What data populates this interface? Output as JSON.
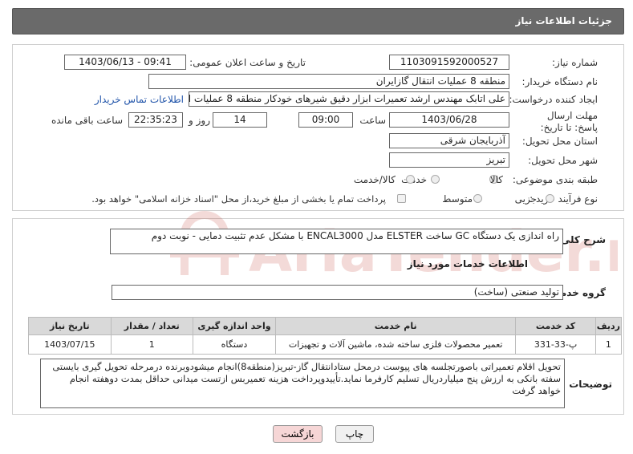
{
  "header": {
    "title": "جزئیات اطلاعات نیاز"
  },
  "fields": {
    "need_number_label": "شماره نیاز:",
    "need_number_value": "1103091592000527",
    "announce_label": "تاریخ و ساعت اعلان عمومی:",
    "announce_value": "1403/06/13 - 09:41",
    "buyer_org_label": "نام دستگاه خریدار:",
    "buyer_org_value": "منطقه 8 عملیات انتقال گازایران",
    "requester_label": "ایجاد کننده درخواست:",
    "requester_value": "علی اتابک مهندس ارشد تعمیرات ابزار دقیق شیرهای خودکار منطقه 8 عملیات از",
    "contact_link": "اطلاعات تماس خریدار",
    "deadline_label": "مهلت ارسال پاسخ: تا تاریخ:",
    "deadline_date": "1403/06/28",
    "time_label": "ساعت",
    "deadline_time": "09:00",
    "days_value": "14",
    "days_label": "روز و",
    "remaining_time": "22:35:23",
    "remaining_label": "ساعت باقی مانده",
    "province_label": "استان محل تحویل:",
    "province_value": "آذربایجان شرقی",
    "city_label": "شهر محل تحویل:",
    "city_value": "تبریز",
    "category_label": "طبقه بندی موضوعی:",
    "category_options": [
      "کالا",
      "خدمت",
      "کالا/خدمت"
    ],
    "process_label": "نوع فرآیند خرید :",
    "process_options": [
      "جزیی",
      "متوسط"
    ],
    "payment_note": "پرداخت تمام یا بخشی از مبلغ خرید،از محل \"اسناد خزانه اسلامی\" خواهد بود."
  },
  "summary": {
    "label": "شرح کلی نیاز:",
    "value": "راه اندازی یک دستگاه GC ساخت ELSTER مدل ENCAL3000 با مشکل عدم تثبیت دمایی - نوبت دوم"
  },
  "services": {
    "section_title": "اطلاعات خدمات مورد نیاز",
    "group_label": "گروه خدمت:",
    "group_value": "تولید صنعتی (ساخت)",
    "columns": [
      "ردیف",
      "کد خدمت",
      "نام خدمت",
      "واحد اندازه گیری",
      "تعداد / مقدار",
      "تاریخ نیاز"
    ],
    "rows": [
      [
        "1",
        "پ-33-331",
        "تعمیر محصولات فلزی ساخته شده، ماشین آلات و تجهیزات",
        "دستگاه",
        "1",
        "1403/07/15"
      ]
    ]
  },
  "buyer_notes": {
    "label": "توضیحات خریدار:",
    "value": "تحویل اقلام تعمیراتی باصورتجلسه های پیوست درمحل ستادانتقال گاز-تبریز(منطقه8)انجام میشودوبرنده درمرحله تحویل گیری بایستی سفته بانکی به ارزش پنج میلیاردریال تسلیم کارفرما نماید.تأییدوپرداخت هزینه تعمیربس ازتست میدانی حداقل بمدت دوهفته انجام خواهد گرفت"
  },
  "buttons": {
    "print": "چاپ",
    "back": "بازگشت"
  },
  "watermark": {
    "text": "AriaTender.net"
  },
  "colors": {
    "header_bg": "#6a6a6a",
    "link": "#2255aa",
    "back_button_bg": "#f6d6d6",
    "watermark": "#c0392b"
  }
}
